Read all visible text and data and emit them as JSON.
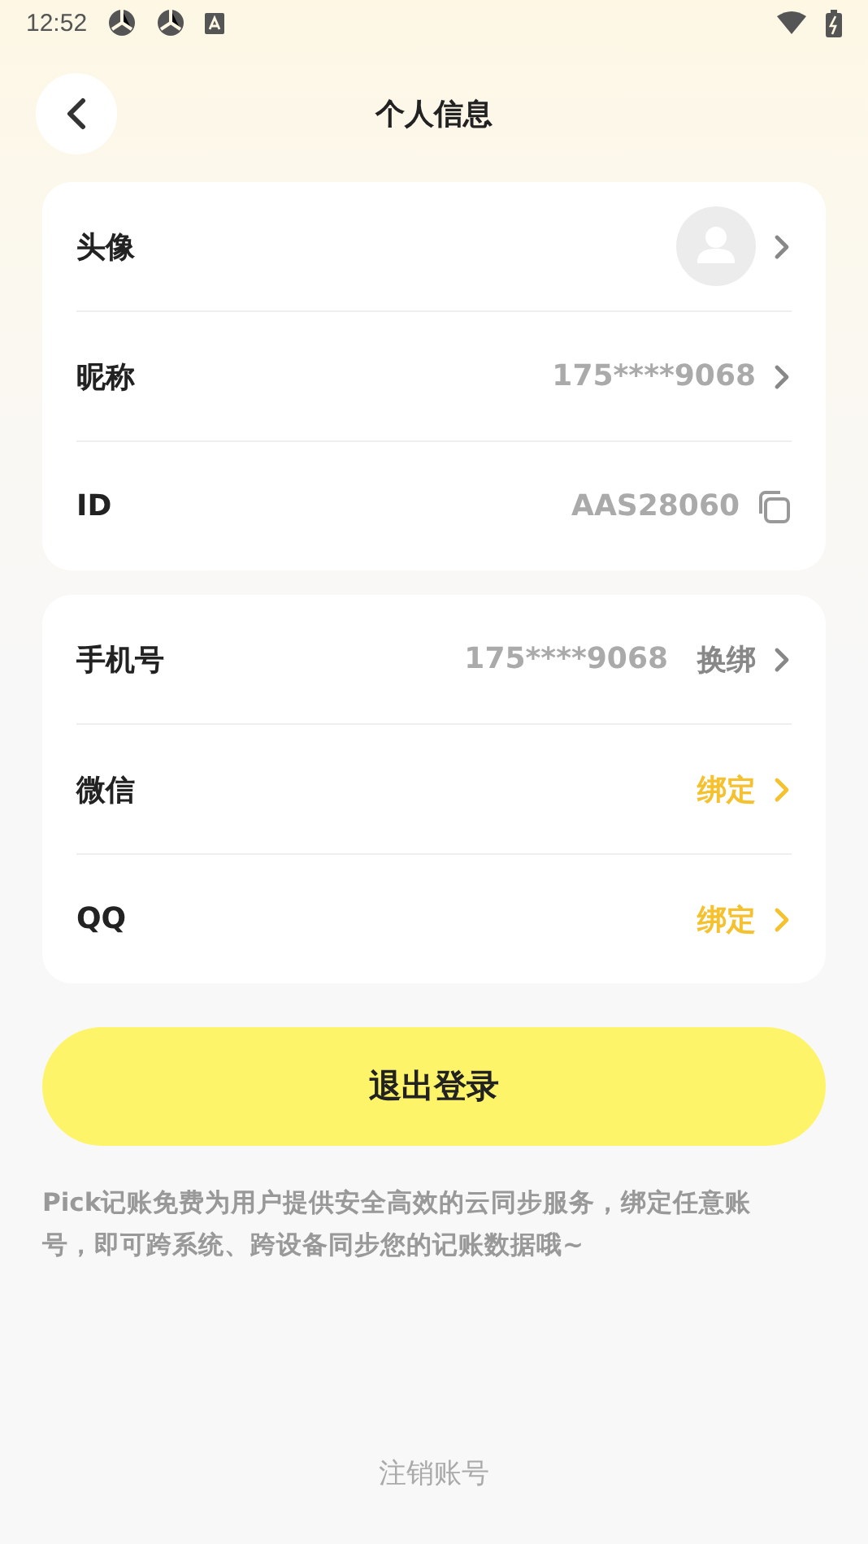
{
  "status_bar": {
    "time": "12:52"
  },
  "header": {
    "title": "个人信息"
  },
  "groups": [
    {
      "rows": [
        {
          "kind": "avatar",
          "label": "头像"
        },
        {
          "kind": "value",
          "label": "昵称",
          "value": "175****9068",
          "color": "#aaaaaa"
        },
        {
          "kind": "copy",
          "label": "ID",
          "value": "AAS28060",
          "color": "#aaaaaa"
        }
      ]
    },
    {
      "rows": [
        {
          "kind": "value",
          "label": "手机号",
          "value": "175****9068",
          "action": "换绑",
          "color": "#aaaaaa"
        },
        {
          "kind": "value",
          "label": "微信",
          "value": "绑定",
          "color": "#f6c12f"
        },
        {
          "kind": "value",
          "label": "QQ",
          "value": "绑定",
          "color": "#f6c12f"
        }
      ]
    }
  ],
  "logout_button": "退出登录",
  "note": "Pick记账免费为用户提供安全高效的云同步服务，绑定任意账号，即可跨系统、跨设备同步您的记账数据哦~",
  "delete_account": "注销账号"
}
